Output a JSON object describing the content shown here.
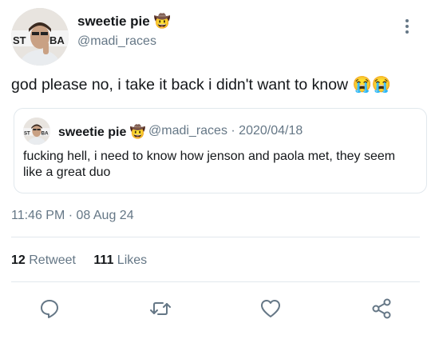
{
  "author": {
    "display_name": "sweetie pie",
    "name_emoji": "🤠",
    "handle": "@madi_races"
  },
  "tweet": {
    "text": "god please no, i take it back i didn't want to know",
    "emojis": "😭😭"
  },
  "quoted_tweet": {
    "display_name": "sweetie pie",
    "name_emoji": "🤠",
    "meta": "@madi_races · 2020/04/18",
    "text": "fucking hell, i  need to know how jenson and paola met, they seem like a great duo"
  },
  "timestamp": "11:46 PM · 08 Aug 24",
  "stats": {
    "retweets_count": "12",
    "retweets_label": "Retweet",
    "likes_count": "111",
    "likes_label": "Likes"
  },
  "actions": [
    "reply-icon",
    "retweet-icon",
    "like-icon",
    "share-icon"
  ],
  "colors": {
    "text": "#14171a",
    "secondary": "#657786",
    "divider": "#e1e8ed"
  }
}
